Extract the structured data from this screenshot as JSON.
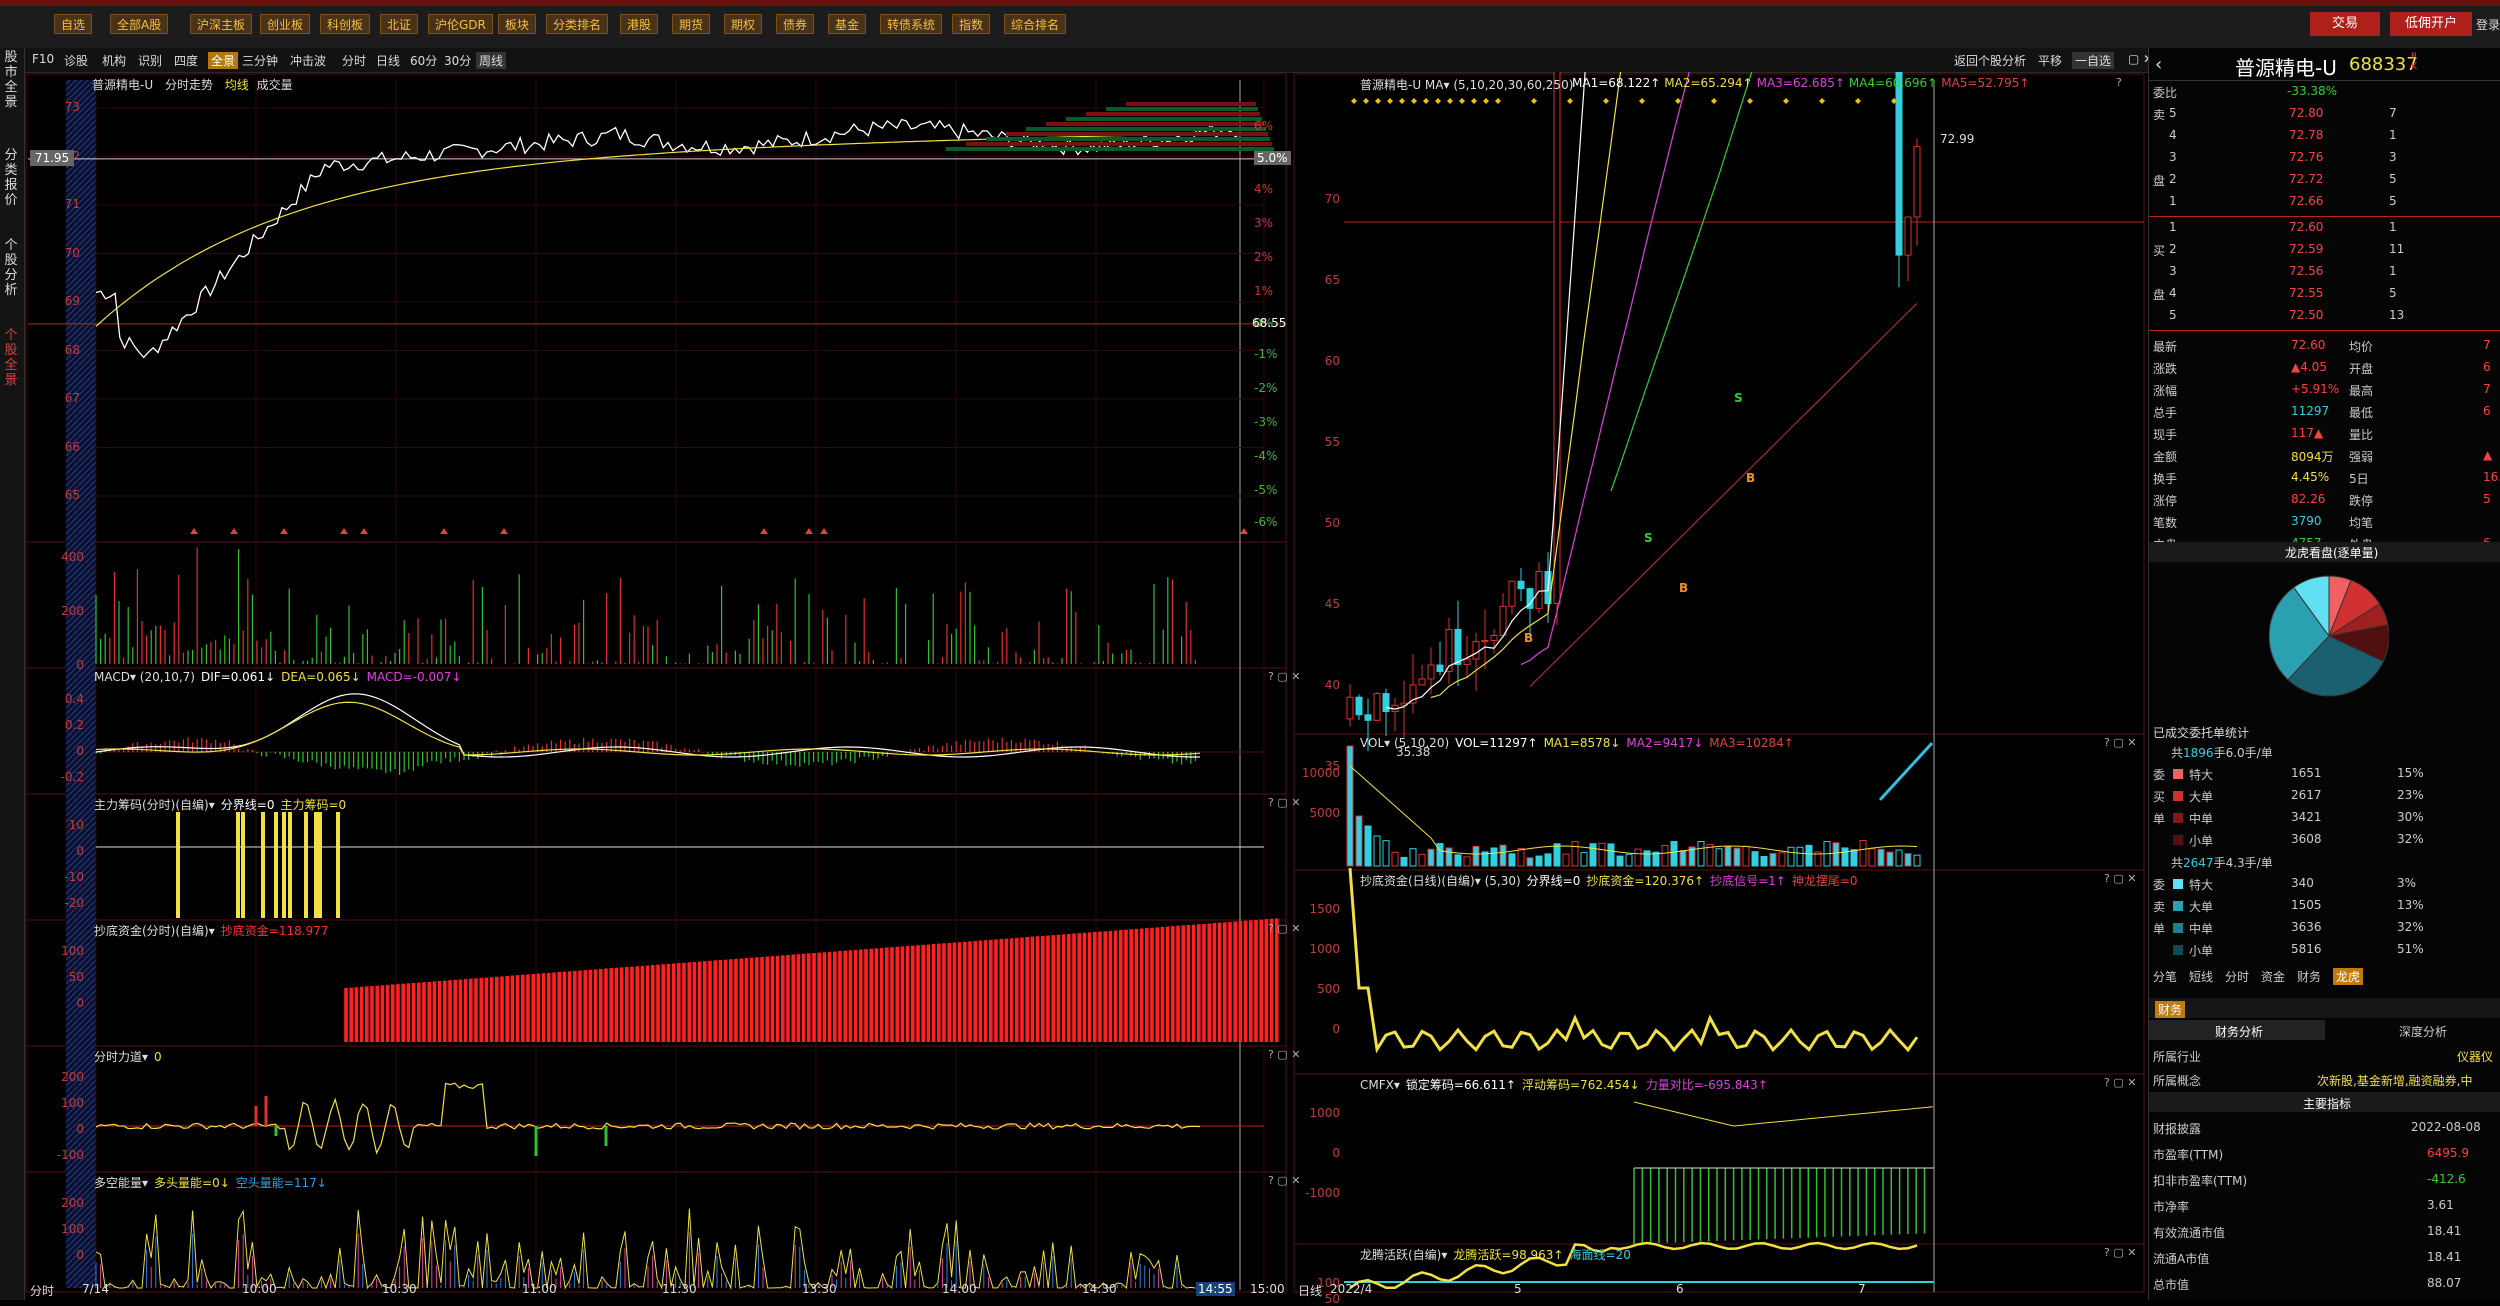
{
  "toolbar": {
    "buttons": [
      "自选",
      "全部A股",
      "沪深主板",
      "创业板",
      "科创板",
      "北证",
      "沪伦GDR",
      "板块",
      "分类排名",
      "港股",
      "期货",
      "期权",
      "债券",
      "基金",
      "转债系统",
      "指数",
      "综合排名"
    ],
    "trade": "交易",
    "open_account": "低佣开户",
    "more": "登录"
  },
  "tabs": {
    "f10": "F10",
    "zhengu": "诊股",
    "jigou": "机构",
    "shibie": "识别",
    "siduo": "四度",
    "full": "全景",
    "sanfen": "三分钟",
    "chongji": "冲击波",
    "periods": [
      "分时",
      "日线",
      "60分",
      "30分"
    ],
    "week": "周线",
    "back": "返回个股分析",
    "pingyi": "平移",
    "zixuan": "一自选"
  },
  "left_tabs": [
    "股市全景",
    "分类报价",
    "个股分析",
    "个股全景"
  ],
  "intraday": {
    "title": "普源精电-U",
    "subtitle": "分时走势",
    "avg": "均线",
    "vol": "成交量",
    "price_ticks": [
      "73",
      "72",
      "71",
      "70",
      "69",
      "68",
      "67",
      "66",
      "65"
    ],
    "pct_ticks": [
      "6%",
      "5.0%",
      "4%",
      "3%",
      "2%",
      "1%",
      "0%",
      "-1%",
      "-2%",
      "-3%",
      "-4%",
      "-5%",
      "-6%"
    ],
    "ref_price": "68.55",
    "cursor_price": "71.95",
    "vol_ticks": [
      "400",
      "200",
      "0"
    ],
    "x_ticks": [
      "7/14",
      "10:00",
      "10:30",
      "11:00",
      "11:30",
      "13:30",
      "14:00",
      "14:30",
      "15:00"
    ],
    "cursor_time": "14:55",
    "bottom_label": "分时"
  },
  "indicators_left": [
    {
      "name": "MACD",
      "head": "MACD▾ (20,10,7)",
      "values": [
        {
          "t": "DIF=0.061↓",
          "c": "#fff"
        },
        {
          "t": "DEA=0.065↓",
          "c": "#f0e040"
        },
        {
          "t": "MACD=-0.007↓",
          "c": "#e040e0"
        }
      ],
      "ticks": [
        "0.4",
        "0.2",
        "0",
        "-0.2"
      ]
    },
    {
      "name": "zhuli",
      "head": "主力筹码(分时)(自编)▾",
      "values": [
        {
          "t": "分界线=0",
          "c": "#fff"
        },
        {
          "t": "主力筹码=0",
          "c": "#f0e040"
        }
      ],
      "ticks": [
        "10",
        "0",
        "-10",
        "-20"
      ]
    },
    {
      "name": "chaodi",
      "head": "抄底资金(分时)(自编)▾",
      "values": [
        {
          "t": "抄底资金=118.977",
          "c": "#ff3030"
        }
      ],
      "ticks": [
        "100",
        "50",
        "0"
      ]
    },
    {
      "name": "lidao",
      "head": "分时力道▾",
      "values": [
        {
          "t": "0",
          "c": "#f0e040"
        }
      ],
      "ticks": [
        "200",
        "100",
        "0",
        "-100"
      ]
    },
    {
      "name": "duokong",
      "head": "多空能量▾",
      "values": [
        {
          "t": "多头量能=0↓",
          "c": "#f0e040"
        },
        {
          "t": "空头量能=117↓",
          "c": "#30a0e0"
        }
      ],
      "ticks": [
        "200",
        "100",
        "0"
      ]
    }
  ],
  "daily": {
    "head": "普源精电-U  MA▾ (5,10,20,30,60,250)",
    "ma": [
      {
        "t": "MA1=68.122↑",
        "c": "#fff"
      },
      {
        "t": "MA2=65.294↑",
        "c": "#f0e040"
      },
      {
        "t": "MA3=62.685↑",
        "c": "#e040e0"
      },
      {
        "t": "MA4=60.696↑",
        "c": "#30d030"
      },
      {
        "t": "MA5=52.795↑",
        "c": "#e04040"
      }
    ],
    "ticks": [
      "70",
      "65",
      "60",
      "55",
      "50",
      "45",
      "40",
      "35"
    ],
    "high": "72.99",
    "low": "35.38",
    "x_ticks": [
      "2022/4",
      "5",
      "6",
      "7"
    ],
    "bottom_label": "日线"
  },
  "indicators_right": [
    {
      "name": "vol",
      "head": "VOL▾ (5,10,20)",
      "values": [
        {
          "t": "VOL=11297↑",
          "c": "#fff"
        },
        {
          "t": "MA1=8578↓",
          "c": "#f0e040"
        },
        {
          "t": "MA2=9417↓",
          "c": "#e040e0"
        },
        {
          "t": "MA3=10284↑",
          "c": "#e04040"
        }
      ],
      "ticks": [
        "10000",
        "5000"
      ]
    },
    {
      "name": "chaodi-day",
      "head": "抄底资金(日线)(自编)▾ (5,30)",
      "values": [
        {
          "t": "分界线=0",
          "c": "#fff"
        },
        {
          "t": "抄底资金=120.376↑",
          "c": "#f0e040"
        },
        {
          "t": "抄底信号=1↑",
          "c": "#e040e0"
        },
        {
          "t": "神龙摆尾=0",
          "c": "#e04040"
        }
      ],
      "ticks": [
        "1500",
        "1000",
        "500",
        "0"
      ]
    },
    {
      "name": "cmfx",
      "head": "CMFX▾",
      "values": [
        {
          "t": "锁定筹码=66.611↑",
          "c": "#fff"
        },
        {
          "t": "浮动筹码=762.454↓",
          "c": "#f0e040"
        },
        {
          "t": "力量对比=-695.843↑",
          "c": "#e040e0"
        }
      ],
      "ticks": [
        "1000",
        "0",
        "-1000"
      ]
    },
    {
      "name": "longteng",
      "head": "龙腾活跃(自编)▾",
      "values": [
        {
          "t": "龙腾活跃=98.963↑",
          "c": "#f0e040"
        },
        {
          "t": "海面线=20",
          "c": "#30d0e0"
        }
      ],
      "ticks": [
        "100",
        "50"
      ]
    }
  ],
  "quote": {
    "name": "普源精电-U",
    "code": "688337",
    "weibi_label": "委比",
    "weibi": "-33.38%",
    "asks": [
      [
        "卖",
        "5",
        "72.80",
        "7"
      ],
      [
        "",
        "4",
        "72.78",
        "1"
      ],
      [
        "",
        "3",
        "72.76",
        "3"
      ],
      [
        "盘",
        "2",
        "72.72",
        "5"
      ],
      [
        "",
        "1",
        "72.66",
        "5"
      ]
    ],
    "bids": [
      [
        "",
        "1",
        "72.60",
        "1"
      ],
      [
        "买",
        "2",
        "72.59",
        "11"
      ],
      [
        "",
        "3",
        "72.56",
        "1"
      ],
      [
        "盘",
        "4",
        "72.55",
        "5"
      ],
      [
        "",
        "5",
        "72.50",
        "13"
      ]
    ],
    "stats": [
      [
        "最新",
        "72.60",
        "均价",
        "7"
      ],
      [
        "涨跌",
        "▲4.05",
        "开盘",
        "6"
      ],
      [
        "涨幅",
        "+5.91%",
        "最高",
        "7"
      ],
      [
        "总手",
        "11297",
        "最低",
        "6"
      ],
      [
        "现手",
        "117▲",
        "量比",
        ""
      ],
      [
        "金额",
        "8094万",
        "强弱",
        "▲"
      ],
      [
        "换手",
        "4.45%",
        "5日",
        "16."
      ],
      [
        "涨停",
        "82.26",
        "跌停",
        "5"
      ],
      [
        "笔数",
        "3790",
        "均笔",
        ""
      ],
      [
        "内盘",
        "4757",
        "外盘",
        "6"
      ]
    ],
    "pie_title": "龙虎看盘(逐单量)",
    "pie_slices": [
      6,
      10,
      6,
      10,
      30,
      28,
      10
    ],
    "deal_title": "已成交委托单统计",
    "buy_total_prefix": "共",
    "buy_total_num": "1896",
    "buy_total_suffix": "手6.0手/单",
    "buy_side": [
      "委",
      "买",
      "单"
    ],
    "buy_rows": [
      [
        "特大",
        "1651",
        "15%"
      ],
      [
        "大单",
        "2617",
        "23%"
      ],
      [
        "中单",
        "3421",
        "30%"
      ],
      [
        "小单",
        "3608",
        "32%"
      ]
    ],
    "sell_total_num": "2647",
    "sell_total_suffix": "手4.3手/单",
    "sell_side": [
      "委",
      "卖",
      "单"
    ],
    "sell_rows": [
      [
        "特大",
        "340",
        "3%"
      ],
      [
        "大单",
        "1505",
        "13%"
      ],
      [
        "中单",
        "3636",
        "32%"
      ],
      [
        "小单",
        "5816",
        "51%"
      ]
    ],
    "tabs": [
      "分笔",
      "短线",
      "分时",
      "资金",
      "财务",
      "龙虎"
    ],
    "fin_tab": "财务",
    "fin_sub": [
      "财务分析",
      "深度分析"
    ],
    "industry_label": "所属行业",
    "industry": "仪器仪",
    "concept_label": "所属概念",
    "concept": "次新股,基金新增,融资融券,中",
    "main_index": "主要指标",
    "fin_rows": [
      [
        "财报披露",
        "2022-08-08"
      ],
      [
        "市盈率(TTM)",
        "6495.9"
      ],
      [
        "扣非市盈率(TTM)",
        "-412.6"
      ],
      [
        "市净率",
        "3.61"
      ],
      [
        "有效流通市值",
        "18.41"
      ],
      [
        "流通A市值",
        "18.41"
      ],
      [
        "总市值",
        "88.07"
      ]
    ]
  }
}
